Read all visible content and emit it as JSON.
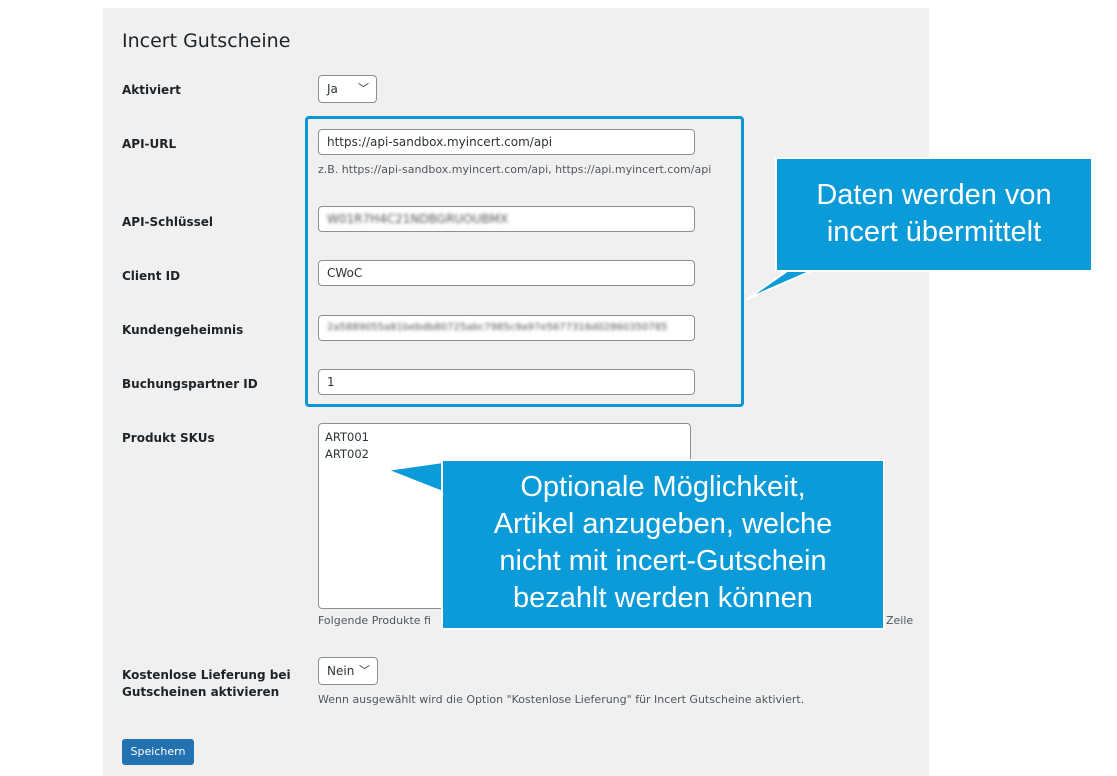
{
  "settings": {
    "title": "Incert Gutscheine",
    "fields": {
      "aktiviert": {
        "label": "Aktiviert",
        "value": "Ja"
      },
      "api_url": {
        "label": "API-URL",
        "value": "https://api-sandbox.myincert.com/api",
        "description": "z.B. https://api-sandbox.myincert.com/api, https://api.myincert.com/api"
      },
      "api_key": {
        "label": "API-Schlüssel",
        "value": "W01R7H4C21NDBGRUOUBMX"
      },
      "client_id": {
        "label": "Client ID",
        "value": "CWoC"
      },
      "kundengeheimnis": {
        "label": "Kundengeheimnis",
        "value": "2a5889055a81bebdb80725abc7985c9a97e5677316d02860350785"
      },
      "buchungspartner_id": {
        "label": "Buchungspartner ID",
        "value": "1"
      },
      "produkt_skus": {
        "label": "Produkt SKUs",
        "lines": [
          "ART001",
          "ART002"
        ],
        "description_start": "Folgende Produkte fi",
        "description_end": "Zeile"
      },
      "kostenlose_lieferung": {
        "label_line1": "Kostenlose Lieferung bei",
        "label_line2": "Gutscheinen aktivieren",
        "value": "Nein",
        "description": "Wenn ausgewählt wird die Option \"Kostenlose Lieferung\" für Incert Gutscheine aktiviert."
      }
    },
    "save_label": "Speichern"
  },
  "callouts": {
    "top": {
      "line1": "Daten werden von",
      "line2": "incert übermittelt"
    },
    "bottom": {
      "line1": "Optionale Möglichkeit,",
      "line2": "Artikel anzugeben, welche",
      "line3": "nicht mit incert-Gutschein",
      "line4": "bezahlt werden können"
    }
  },
  "colors": {
    "callout": "#0a9bd8",
    "button": "#2271b1",
    "panel": "#f0f0f1",
    "highlight": "#0e96d3"
  },
  "icons": {
    "select_arrow": "chevron-down-icon"
  }
}
